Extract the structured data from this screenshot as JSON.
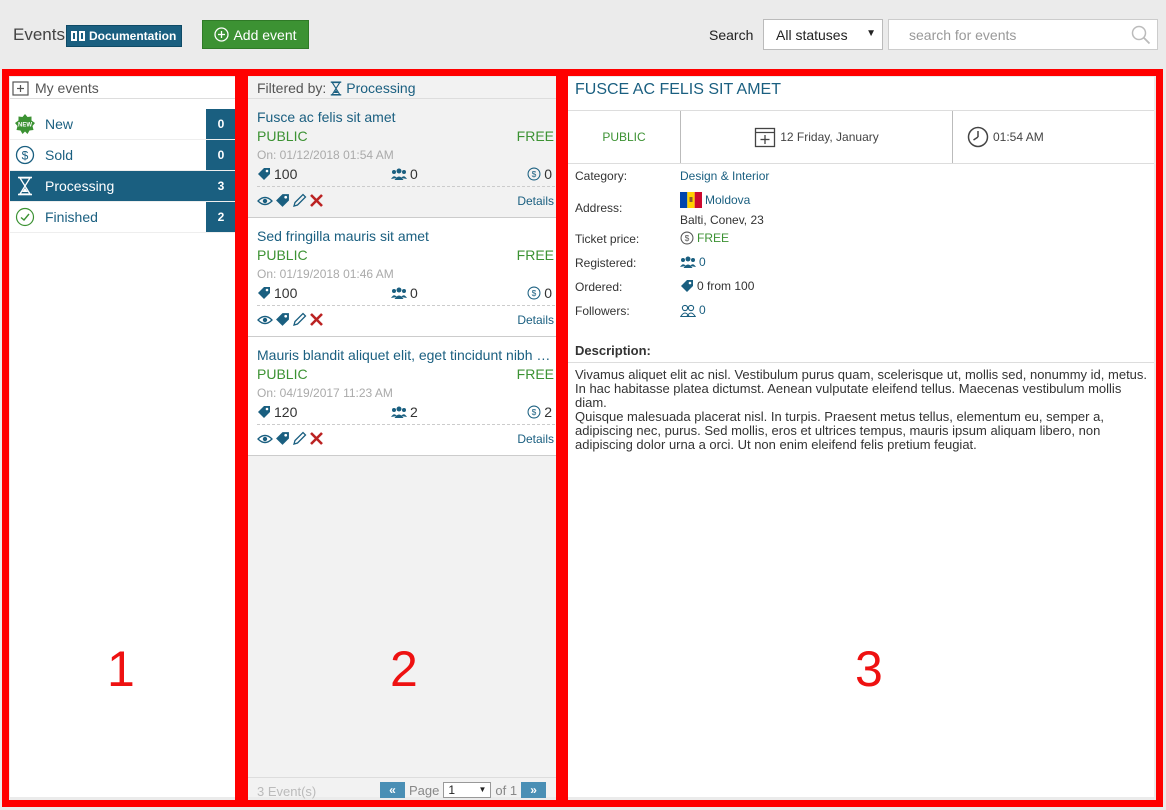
{
  "header": {
    "title": "Events",
    "doc_label": "Documentation",
    "add_label": "Add event",
    "search_label": "Search",
    "status_selected": "All statuses",
    "search_placeholder": "search for events"
  },
  "sidebar": {
    "header": "My events",
    "items": [
      {
        "label": "New",
        "count": "0",
        "icon": "new-badge-icon"
      },
      {
        "label": "Sold",
        "count": "0",
        "icon": "dollar-circle-icon"
      },
      {
        "label": "Processing",
        "count": "3",
        "icon": "hourglass-icon",
        "active": true
      },
      {
        "label": "Finished",
        "count": "2",
        "icon": "check-circle-icon"
      }
    ]
  },
  "list": {
    "filter_label": "Filtered by:",
    "filter_value": "Processing",
    "events": [
      {
        "title": "Fusce ac felis sit amet",
        "visibility": "PUBLIC",
        "price": "FREE",
        "date": "On: 01/12/2018 01:54 AM",
        "tickets": "100",
        "registered": "0",
        "sold": "0",
        "details": "Details"
      },
      {
        "title": "Sed fringilla mauris sit amet",
        "visibility": "PUBLIC",
        "price": "FREE",
        "date": "On: 01/19/2018 01:46 AM",
        "tickets": "100",
        "registered": "0",
        "sold": "0",
        "details": "Details"
      },
      {
        "title": "Mauris blandit aliquet elit, eget tincidunt nibh pulvinar a",
        "visibility": "PUBLIC",
        "price": "FREE",
        "date": "On: 04/19/2017 11:23 AM",
        "tickets": "120",
        "registered": "2",
        "sold": "2",
        "details": "Details"
      }
    ],
    "footer": {
      "count": "3 Event(s)",
      "page_label": "Page",
      "page_value": "1",
      "of_label": "of 1"
    }
  },
  "detail": {
    "title": "FUSCE AC FELIS SIT AMET",
    "visibility": "PUBLIC",
    "date": "12 Friday, January",
    "time": "01:54 AM",
    "labels": {
      "category": "Category:",
      "address": "Address:",
      "ticket_price": "Ticket price:",
      "registered": "Registered:",
      "ordered": "Ordered:",
      "followers": "Followers:"
    },
    "category": "Design & Interior",
    "country": "Moldova",
    "address": "Balti, Conev, 23",
    "ticket_price": "FREE",
    "registered": "0",
    "ordered": "0 from 100",
    "followers": "0",
    "description_label": "Description:",
    "description": "Vivamus aliquet elit ac nisl. Vestibulum purus quam, scelerisque ut, mollis sed, nonummy id, metus. In hac habitasse platea dictumst. Aenean vulputate eleifend tellus. Maecenas vestibulum mollis diam.\nQuisque malesuada placerat nisl. In turpis. Praesent metus tellus, elementum eu, semper a, adipiscing nec, purus. Sed mollis, eros et ultrices tempus, mauris ipsum aliquam libero, non adipiscing dolor urna a orci. Ut non enim eleifend felis pretium feugiat."
  },
  "annotations": {
    "zone1": "1",
    "zone2": "2",
    "zone3": "3"
  },
  "colors": {
    "accent": "#1a5f80",
    "green": "#3c9233",
    "annotation_red": "#ff0000"
  }
}
